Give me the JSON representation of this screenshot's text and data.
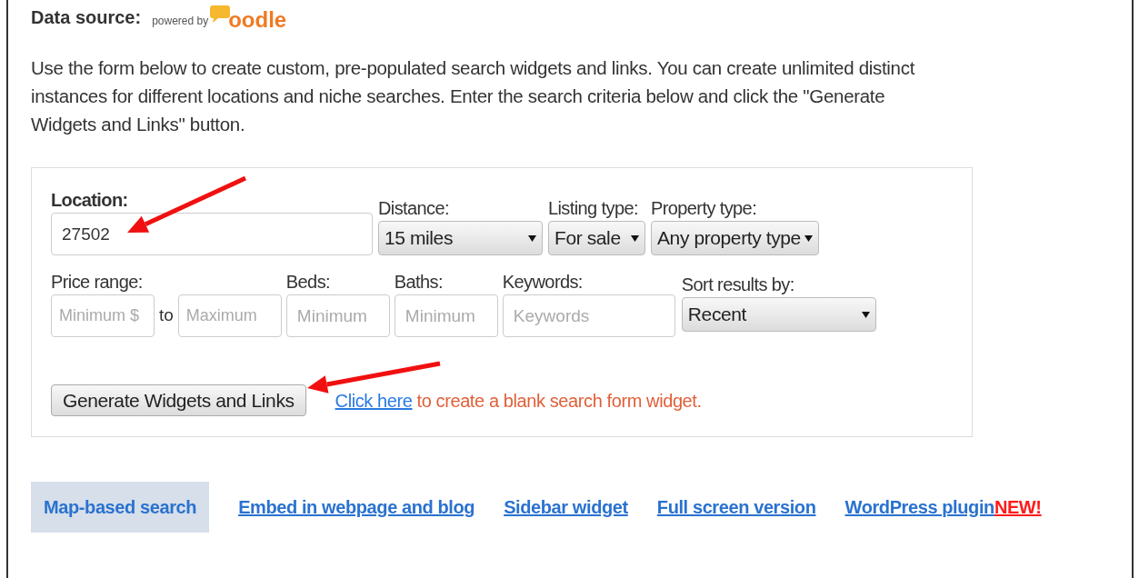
{
  "header": {
    "label": "Data source:",
    "powered_by": "powered by",
    "logo_text": "oodle"
  },
  "intro": "Use the form below to create custom, pre-populated search widgets and links. You can create unlimited distinct instances for different locations and niche searches. Enter the search criteria below and click the \"Generate Widgets and Links\" button.",
  "form": {
    "row_1": [
      {
        "kind": "input",
        "label": "Location:",
        "bold": true,
        "value": "27502"
      },
      {
        "kind": "select",
        "label": "Distance:",
        "bold": false,
        "value": "15 miles"
      },
      {
        "kind": "select",
        "label": "Listing type:",
        "bold": false,
        "value": "For sale"
      },
      {
        "kind": "select",
        "label": "Property type:",
        "bold": false,
        "value": "Any property type"
      }
    ],
    "price_label": "Price range:",
    "price_min": {
      "placeholder": "Minimum $"
    },
    "price_to": "to",
    "price_max": {
      "placeholder": "Maximum"
    },
    "row_2": [
      {
        "kind": "input",
        "label": "Beds:",
        "placeholder": "Minimum"
      },
      {
        "kind": "input",
        "label": "Baths:",
        "placeholder": "Minimum"
      },
      {
        "kind": "input",
        "label": "Keywords:",
        "placeholder": "Keywords"
      },
      {
        "kind": "select",
        "label": "Sort results by:",
        "value": "Recent"
      }
    ],
    "button": "Generate Widgets and Links",
    "link": "Click here",
    "link_tail": "to create a blank search form widget."
  },
  "tabs": [
    {
      "label": "Map-based search",
      "selected": true
    },
    {
      "label": "Embed in webpage and blog",
      "selected": false
    },
    {
      "label": "Sidebar widget",
      "selected": false
    },
    {
      "label": "Full screen version",
      "selected": false
    },
    {
      "label": "WordPress plugin",
      "selected": false,
      "badge": "NEW!"
    }
  ]
}
